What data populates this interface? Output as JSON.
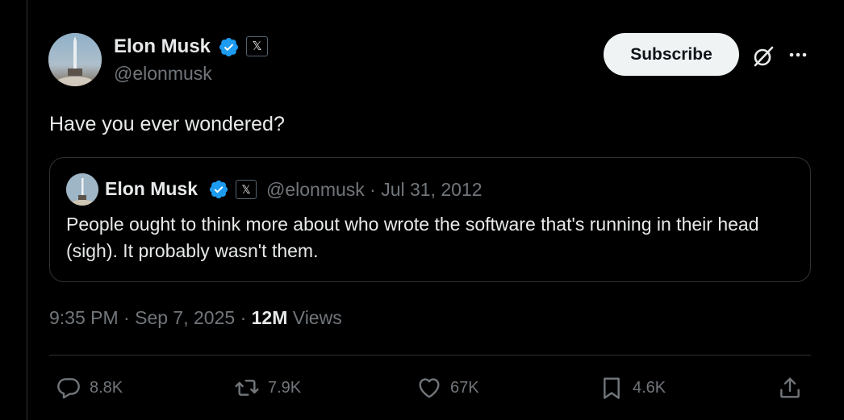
{
  "post": {
    "author_name": "Elon Musk",
    "author_handle": "@elonmusk",
    "text": "Have you ever wondered?",
    "subscribe_label": "Subscribe",
    "time": "9:35 PM",
    "date": "Sep 7, 2025",
    "views_count": "12M",
    "views_label": "Views",
    "sep": "·"
  },
  "quote": {
    "author_name": "Elon Musk",
    "meta": "@elonmusk · Jul 31, 2012",
    "text": "People ought to think more about who wrote the software that's running in their head (sigh). It probably wasn't them."
  },
  "badges": {
    "x_glyph": "𝕏"
  },
  "actions": {
    "replies": "8.8K",
    "reposts": "7.9K",
    "likes": "67K",
    "bookmarks": "4.6K"
  },
  "icons": [
    "verified-badge-icon",
    "x-badge-icon",
    "grok-icon",
    "more-icon",
    "reply-icon",
    "repost-icon",
    "like-icon",
    "bookmark-icon",
    "share-icon"
  ],
  "colors": {
    "background": "#000000",
    "text": "#e7e9ea",
    "muted": "#71767b",
    "verified": "#1d9bf0",
    "border": "#2f3336"
  }
}
